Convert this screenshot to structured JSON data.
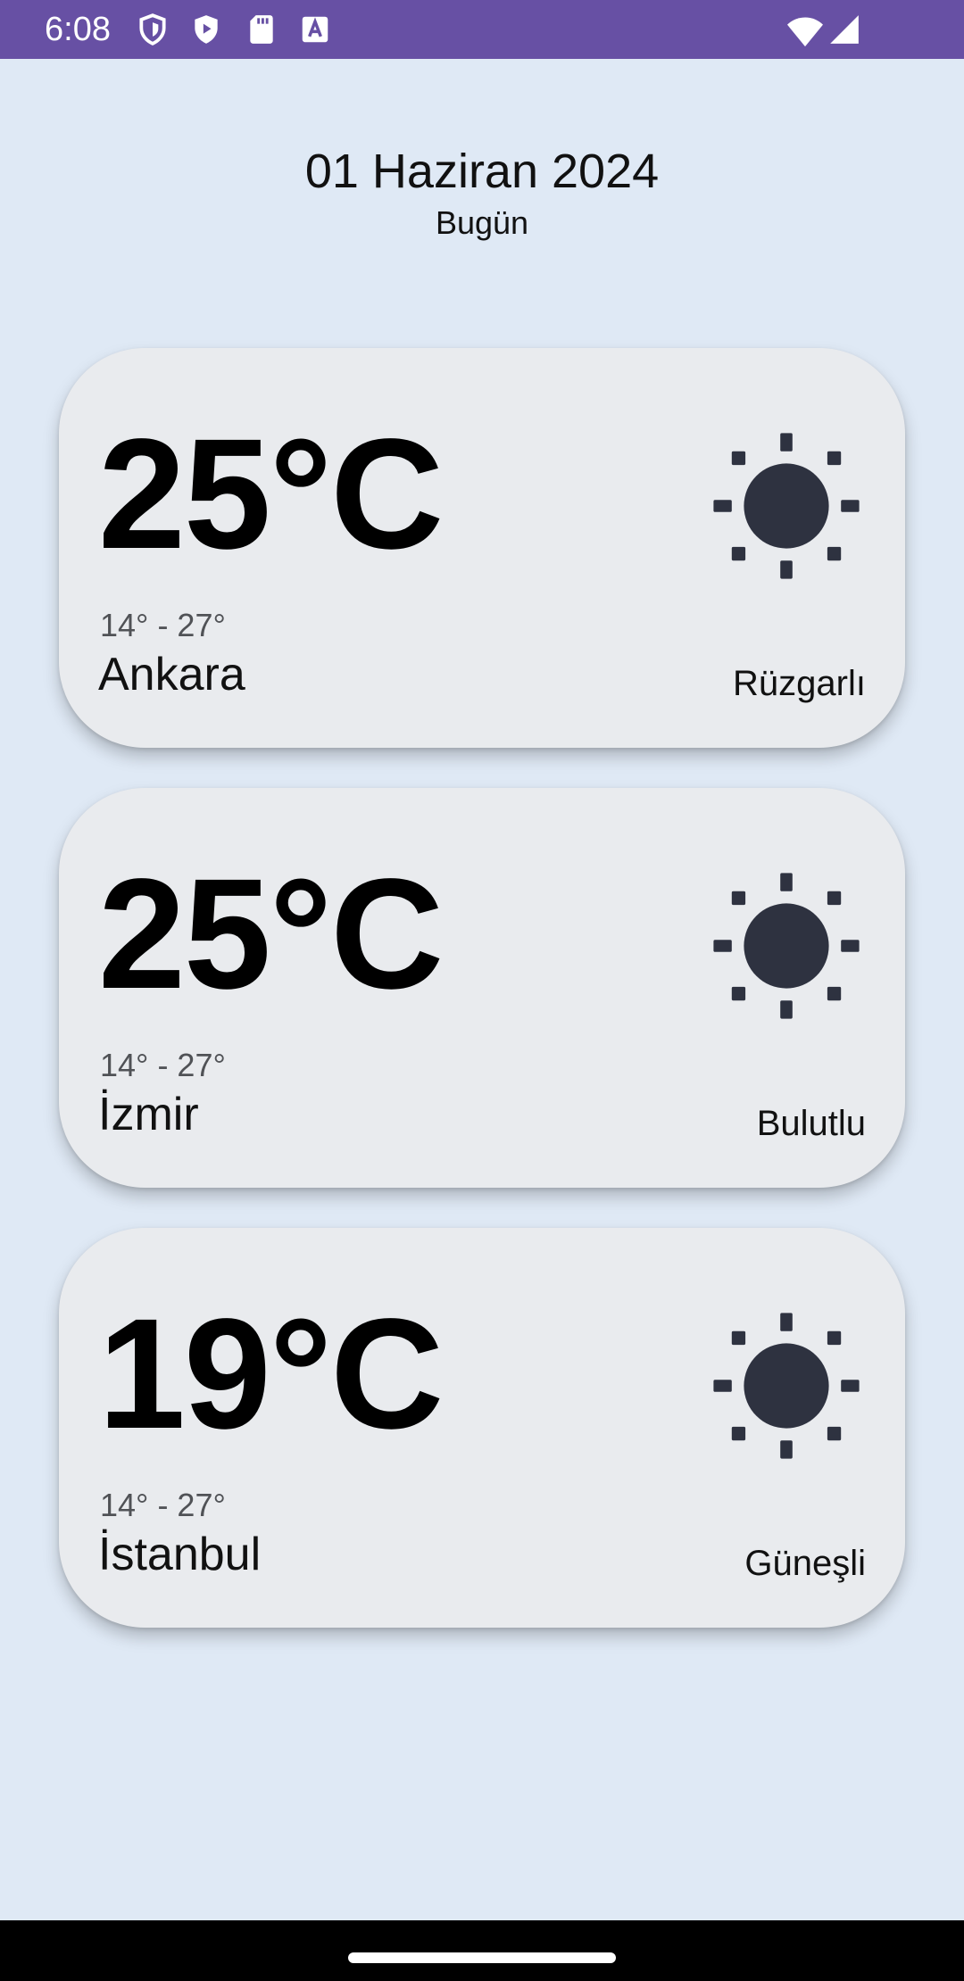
{
  "status_bar": {
    "time": "6:08",
    "left_icons": [
      "shield-outline-icon",
      "shield-play-icon",
      "sd-card-icon",
      "font-a-icon"
    ],
    "right_icons": [
      "wifi-icon",
      "signal-icon"
    ],
    "color": "#6750a4"
  },
  "header": {
    "date": "01 Haziran 2024",
    "subtitle": "Bugün"
  },
  "cards": [
    {
      "temp": "25°C",
      "range": "14° - 27°",
      "city": "Ankara",
      "condition": "Rüzgarlı",
      "icon": "sun-icon"
    },
    {
      "temp": "25°C",
      "range": "14° - 27°",
      "city": "İzmir",
      "condition": "Bulutlu",
      "icon": "sun-icon"
    },
    {
      "temp": "19°C",
      "range": "14° - 27°",
      "city": "İstanbul",
      "condition": "Güneşli",
      "icon": "sun-icon"
    }
  ],
  "colors": {
    "background": "#dfe9f5",
    "card": "#e9ebee",
    "icon": "#2e3240"
  }
}
